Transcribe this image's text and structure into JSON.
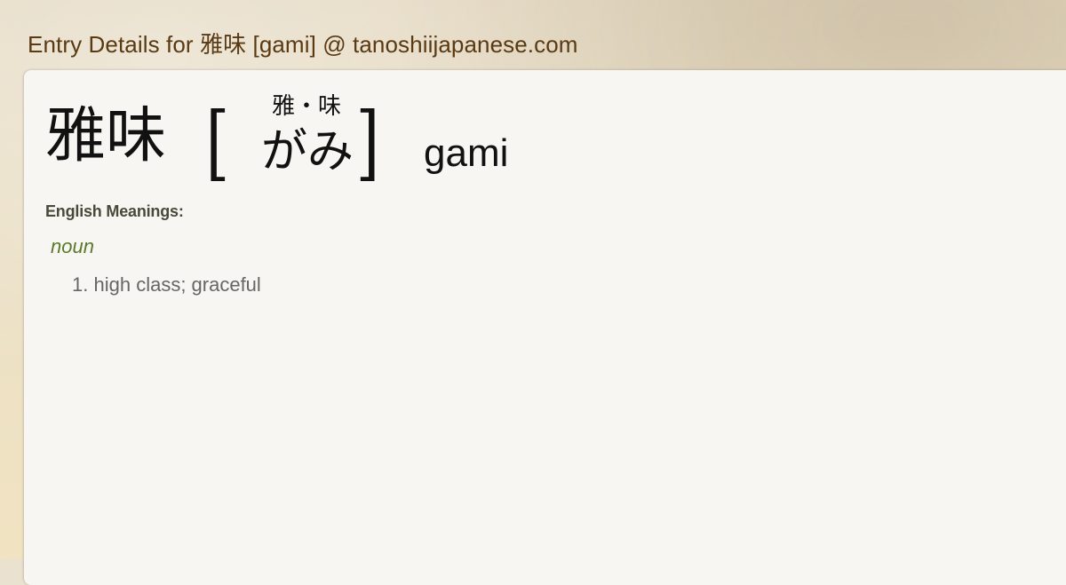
{
  "page": {
    "title": "Entry Details for 雅味 [gami] @ tanoshiijapanese.com"
  },
  "entry": {
    "kanji": "雅味",
    "bracket_open": "[",
    "bracket_close": "]",
    "furigana_kanji": "雅・味",
    "furigana_kana": "がみ",
    "romaji": "gami"
  },
  "meanings": {
    "heading": "English Meanings:",
    "part_of_speech": "noun",
    "items": [
      {
        "number": "1.",
        "text": "high class; graceful"
      }
    ]
  },
  "colors": {
    "title": "#5a3a12",
    "part_of_speech": "#5a7a28",
    "meaning_text": "#666666",
    "card_background": "#f7f6f3"
  }
}
